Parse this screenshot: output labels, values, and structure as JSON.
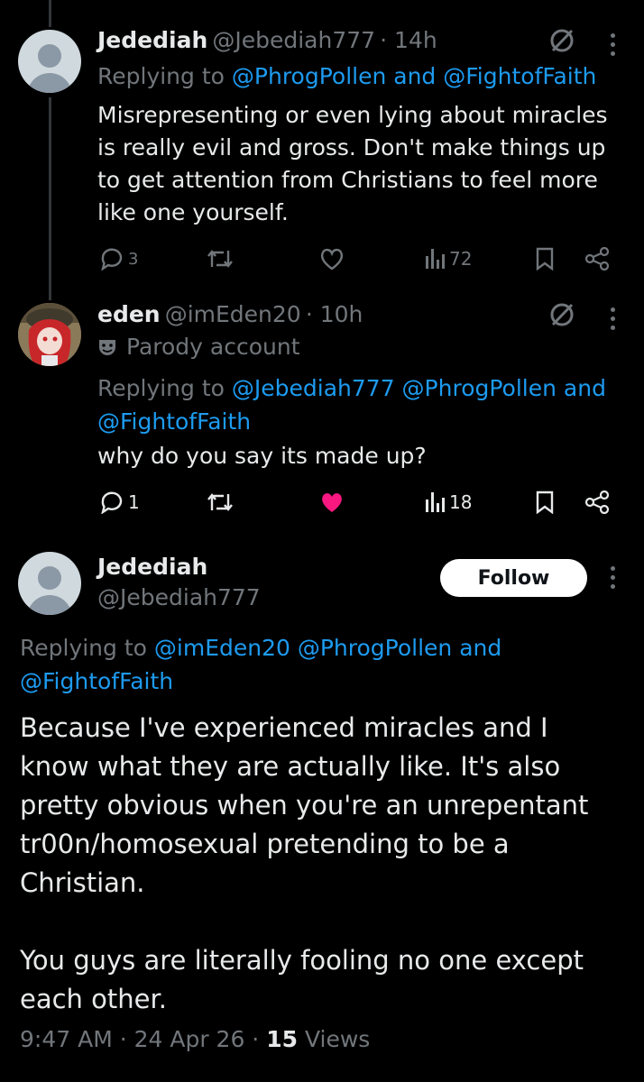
{
  "tweet1": {
    "display_name": "Jedediah",
    "handle": "@Jebediah777",
    "time": "· 14h",
    "replying_prefix": "Replying to",
    "replying_to": "@PhrogPollen and @FightofFaith",
    "text_lines": [
      "Misrepresenting or even lying about miracles",
      "is really evil and gross. Don't make things up",
      "to get attention from Christians to feel more",
      "like one yourself."
    ],
    "reply_count": "3",
    "views": "72"
  },
  "tweet2": {
    "display_name": "eden",
    "handle": "@imEden20",
    "time": "· 10h",
    "parody_label": "Parody account",
    "replying_prefix": "Replying to",
    "replying_line1": "@Jebediah777 @PhrogPollen and",
    "replying_line2": "@FightofFaith",
    "text": "why do you say its made up?",
    "reply_count": "1",
    "views": "18",
    "liked_color": "#f91880"
  },
  "main_tweet": {
    "display_name": "Jedediah",
    "handle": "@Jebediah777",
    "follow_label": "Follow",
    "replying_prefix": "Replying to",
    "replying_line1": "@imEden20 @PhrogPollen and",
    "replying_line2": "@FightofFaith",
    "text": "Because I've experienced miracles and I\nknow what they are actually like. It's also\npretty obvious when you're an unrepentant\ntr00n/homosexual pretending to be a\nChristian.\n\nYou guys are literally fooling no one except\neach other.",
    "timestamp": "9:47 AM · 24 Apr 26 ·",
    "views_count": "15",
    "views_label": "Views"
  },
  "colors": {
    "background": "#000000",
    "link": "#1d9bf0",
    "muted": "#71767b",
    "like": "#f91880"
  },
  "icons": [
    "reply-icon",
    "retweet-icon",
    "like-icon",
    "views-icon",
    "bookmark-icon",
    "share-icon",
    "grok-icon",
    "more-icon",
    "parody-mask-icon"
  ]
}
